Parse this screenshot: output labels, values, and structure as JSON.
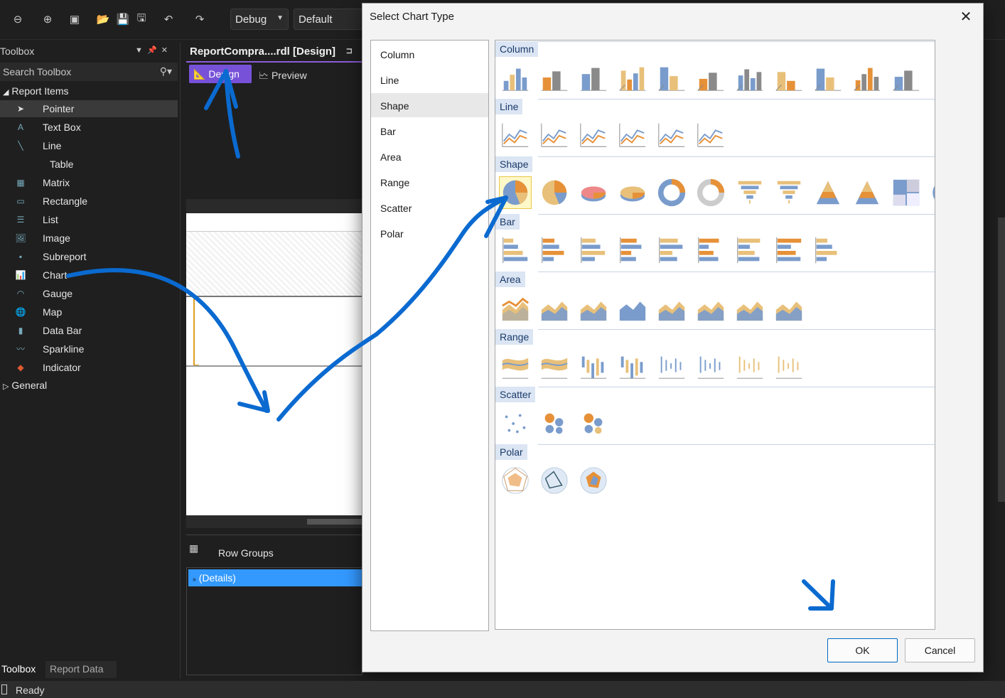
{
  "toolbar": {
    "config": "Debug",
    "platform": "Default"
  },
  "toolbox": {
    "title": "Toolbox",
    "search_placeholder": "Search Toolbox",
    "group": "Report Items",
    "items": [
      {
        "label": "Pointer",
        "icon": "pointer-icon"
      },
      {
        "label": "Text Box",
        "icon": "textbox-icon"
      },
      {
        "label": "Line",
        "icon": "line-icon"
      },
      {
        "label": "Table",
        "icon": "table-icon"
      },
      {
        "label": "Matrix",
        "icon": "matrix-icon"
      },
      {
        "label": "Rectangle",
        "icon": "rectangle-icon"
      },
      {
        "label": "List",
        "icon": "list-icon"
      },
      {
        "label": "Image",
        "icon": "image-icon"
      },
      {
        "label": "Subreport",
        "icon": "subreport-icon"
      },
      {
        "label": "Chart",
        "icon": "chart-icon"
      },
      {
        "label": "Gauge",
        "icon": "gauge-icon"
      },
      {
        "label": "Map",
        "icon": "map-icon"
      },
      {
        "label": "Data Bar",
        "icon": "databar-icon"
      },
      {
        "label": "Sparkline",
        "icon": "sparkline-icon"
      },
      {
        "label": "Indicator",
        "icon": "indicator-icon"
      }
    ],
    "general": "General",
    "bottom_tabs": [
      "Toolbox",
      "Report Data"
    ]
  },
  "document": {
    "tab": "ReportCompra....rdl [Design]",
    "design_tab": "Design",
    "preview_tab": "Preview",
    "row_groups": "Row Groups",
    "details": "(Details)"
  },
  "dialog": {
    "title": "Select Chart Type",
    "categories": [
      "Column",
      "Line",
      "Shape",
      "Bar",
      "Area",
      "Range",
      "Scatter",
      "Polar"
    ],
    "selected_category": "Shape",
    "sections": [
      {
        "name": "Column",
        "count": 11
      },
      {
        "name": "Line",
        "count": 6
      },
      {
        "name": "Shape",
        "count": 12
      },
      {
        "name": "Bar",
        "count": 9
      },
      {
        "name": "Area",
        "count": 8
      },
      {
        "name": "Range",
        "count": 8
      },
      {
        "name": "Scatter",
        "count": 3
      },
      {
        "name": "Polar",
        "count": 3
      }
    ],
    "ok": "OK",
    "cancel": "Cancel"
  },
  "status": {
    "text": "Ready"
  },
  "colors": {
    "accent": "#7752d8",
    "selection": "#3399ff",
    "annotation": "#0a6ad0",
    "blue": "#7a9ccc",
    "orange": "#e69138",
    "tan": "#e8c07a"
  }
}
